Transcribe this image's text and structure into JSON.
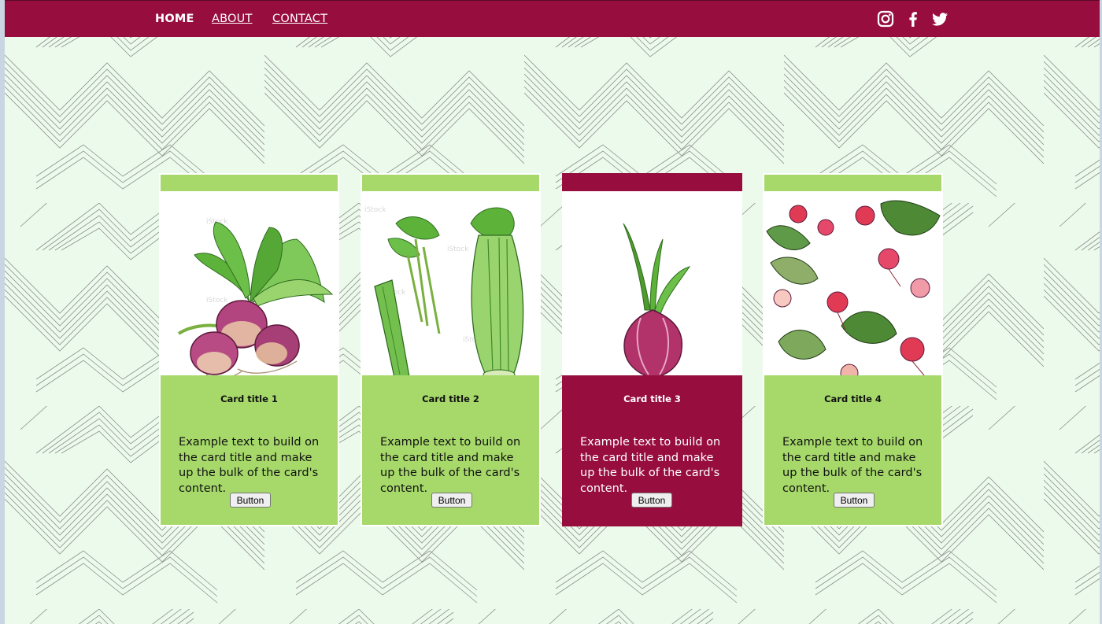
{
  "nav": {
    "links": [
      {
        "label": "HOME",
        "active": true
      },
      {
        "label": "ABOUT",
        "active": false
      },
      {
        "label": "CONTACT",
        "active": false
      }
    ],
    "social_icons": [
      "instagram-icon",
      "facebook-icon",
      "twitter-icon"
    ]
  },
  "colors": {
    "brand": "#970e3e",
    "accent_green": "#a6d96a",
    "background": "#ecfaec"
  },
  "cards": [
    {
      "title": "Card title 1",
      "text": "Example text to build on the card title and make up the bulk of the card's content.",
      "button": "Button",
      "theme": "green",
      "image": "turnip-illustration"
    },
    {
      "title": "Card title 2",
      "text": "Example text to build on the card title and make up the bulk of the card's content.",
      "button": "Button",
      "theme": "green",
      "image": "celery-illustration"
    },
    {
      "title": "Card title 3",
      "text": "Example text to build on the card title and make up the bulk of the card's content.",
      "button": "Button",
      "theme": "red",
      "image": "onion-illustration"
    },
    {
      "title": "Card title 4",
      "text": "Example text to build on the card title and make up the bulk of the card's content.",
      "button": "Button",
      "theme": "green",
      "image": "radish-illustration"
    }
  ]
}
